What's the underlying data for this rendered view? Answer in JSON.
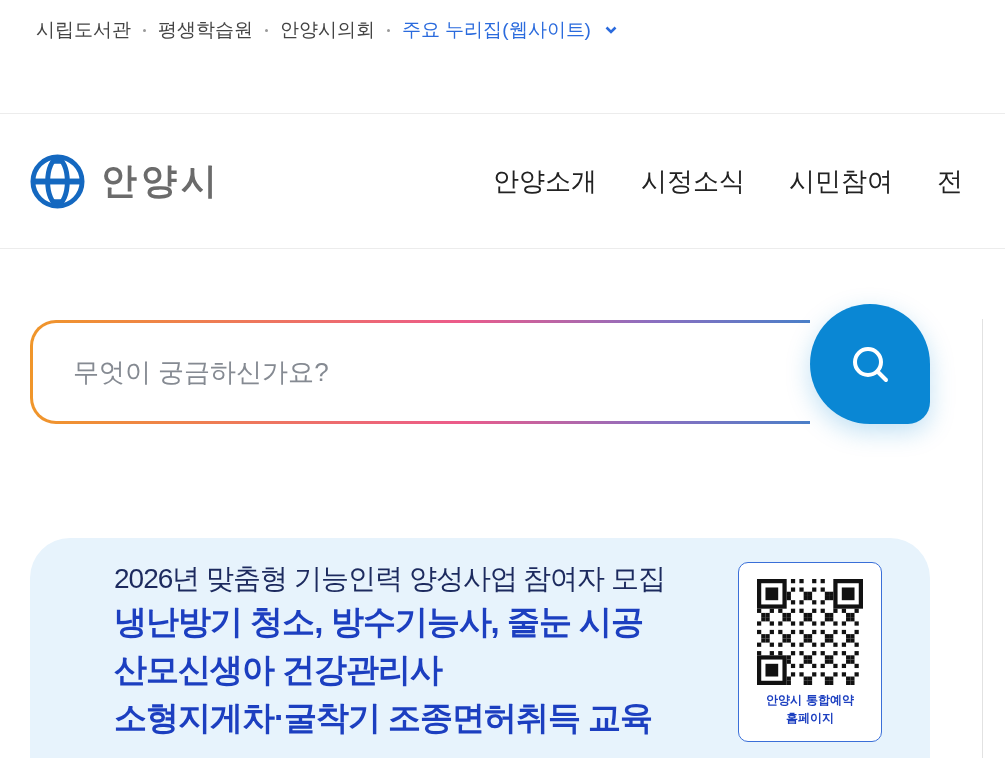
{
  "top_links": [
    {
      "label": "시립도서관",
      "kind": "link"
    },
    {
      "label": "평생학습원",
      "kind": "link"
    },
    {
      "label": "안양시의회",
      "kind": "link"
    },
    {
      "label": "주요 누리집(웹사이트)",
      "kind": "dropdown"
    }
  ],
  "logo": {
    "name": "안양시"
  },
  "nav": [
    "안양소개",
    "시정소식",
    "시민참여",
    "전"
  ],
  "search": {
    "placeholder": "무엇이 궁금하신가요?"
  },
  "banner": {
    "subtitle": "2026년 맞춤형 기능인력 양성사업 참여자 모집",
    "headlines": [
      "냉난방기 청소, 방수기능사, 줄눈 시공",
      "산모신생아 건강관리사",
      "소형지게차·굴착기 조종면허취득 교육"
    ],
    "qr_caption": [
      "안양시 통합예약",
      "홈페이지"
    ]
  }
}
